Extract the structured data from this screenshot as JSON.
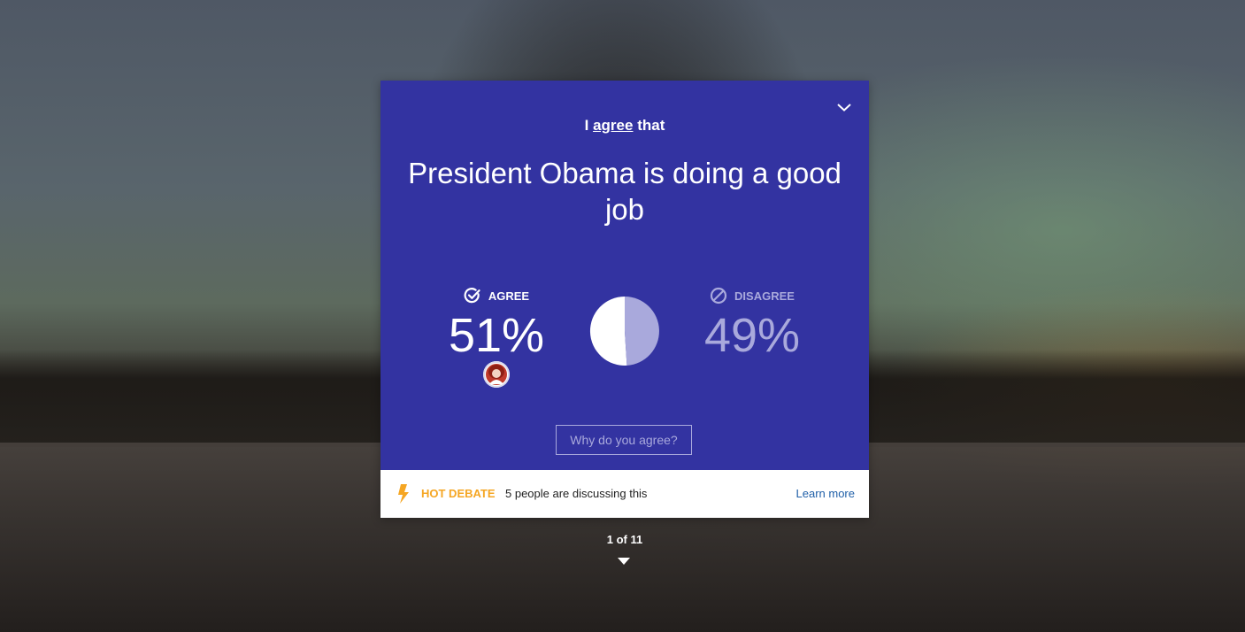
{
  "card": {
    "intro_prefix": "I",
    "intro_verb": "agree",
    "intro_suffix": "that",
    "statement": "President Obama is doing a good job",
    "agree": {
      "label": "AGREE",
      "percent": "51%",
      "value": 51
    },
    "disagree": {
      "label": "DISAGREE",
      "percent": "49%",
      "value": 49
    },
    "why_button": "Why do you agree?",
    "icons": {
      "collapse": "chevron-down-icon",
      "agree": "check-circle-icon",
      "disagree": "prohibited-icon",
      "hot": "lightning-bolt-icon"
    },
    "colors": {
      "card_bg": "#3333a1",
      "agree": "#ffffff",
      "disagree": "#a9a9dc",
      "hot": "#f5a623",
      "link": "#1f5fa8"
    }
  },
  "footer": {
    "hot_label": "HOT DEBATE",
    "discussing": "5 people are discussing this",
    "learn_more": "Learn more"
  },
  "pager": {
    "text": "1 of 11",
    "current": 1,
    "total": 11
  }
}
